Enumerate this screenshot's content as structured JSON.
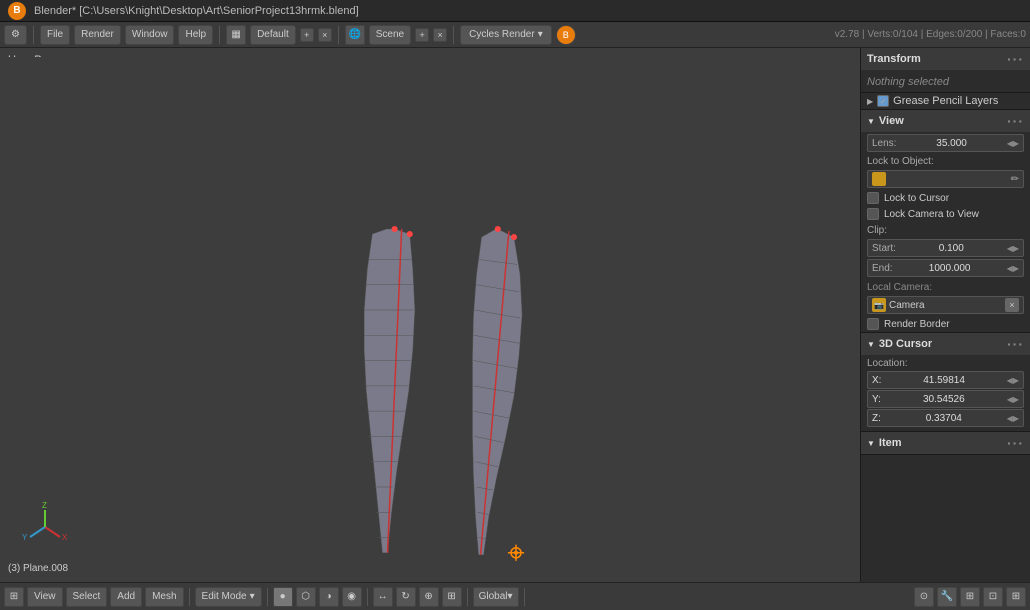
{
  "titlebar": {
    "title": "Blender* [C:\\Users\\Knight\\Desktop\\Art\\SeniorProject13hrmk.blend]",
    "logo": "B"
  },
  "toolbar": {
    "file": "File",
    "render": "Render",
    "window": "Window",
    "help": "Help",
    "layout": "Default",
    "scene": "Scene",
    "render_engine": "Cycles Render",
    "version": "v2.78 | Verts:0/104 | Edges:0/200 | Faces:0"
  },
  "viewport": {
    "label": "User Persp",
    "object_label": "(3) Plane.008"
  },
  "right_panel": {
    "transform_header": "Transform",
    "nothing_selected": "Nothing selected",
    "grease_pencil": "Grease Pencil Layers",
    "view_header": "View",
    "lens_label": "Lens:",
    "lens_value": "35.000",
    "lock_to_object_label": "Lock to Object:",
    "lock_to_cursor_label": "Lock to Cursor",
    "lock_camera_label": "Lock Camera to View",
    "clip_label": "Clip:",
    "start_label": "Start:",
    "start_value": "0.100",
    "end_label": "End:",
    "end_value": "1000.000",
    "local_camera_label": "Local Camera:",
    "camera_label": "Camera",
    "render_border_label": "Render Border",
    "cursor_3d_header": "3D Cursor",
    "location_label": "Location:",
    "x_label": "X:",
    "x_value": "41.59814",
    "y_label": "Y:",
    "y_value": "30.54526",
    "z_label": "Z:",
    "z_value": "0.33704",
    "item_header": "Item"
  },
  "bottom_toolbar": {
    "view_label": "View",
    "select_label": "Select",
    "add_label": "Add",
    "mesh_label": "Mesh",
    "mode_label": "Edit Mode",
    "global_label": "Global"
  },
  "colors": {
    "accent_orange": "#e87d0d",
    "camera_gold": "#c8961a",
    "header_bg": "#3a3a3a",
    "panel_bg": "#2c2c2c",
    "viewport_bg": "#3d3d3d",
    "field_bg": "#3a3a3a",
    "selection_blue": "#6699cc"
  }
}
